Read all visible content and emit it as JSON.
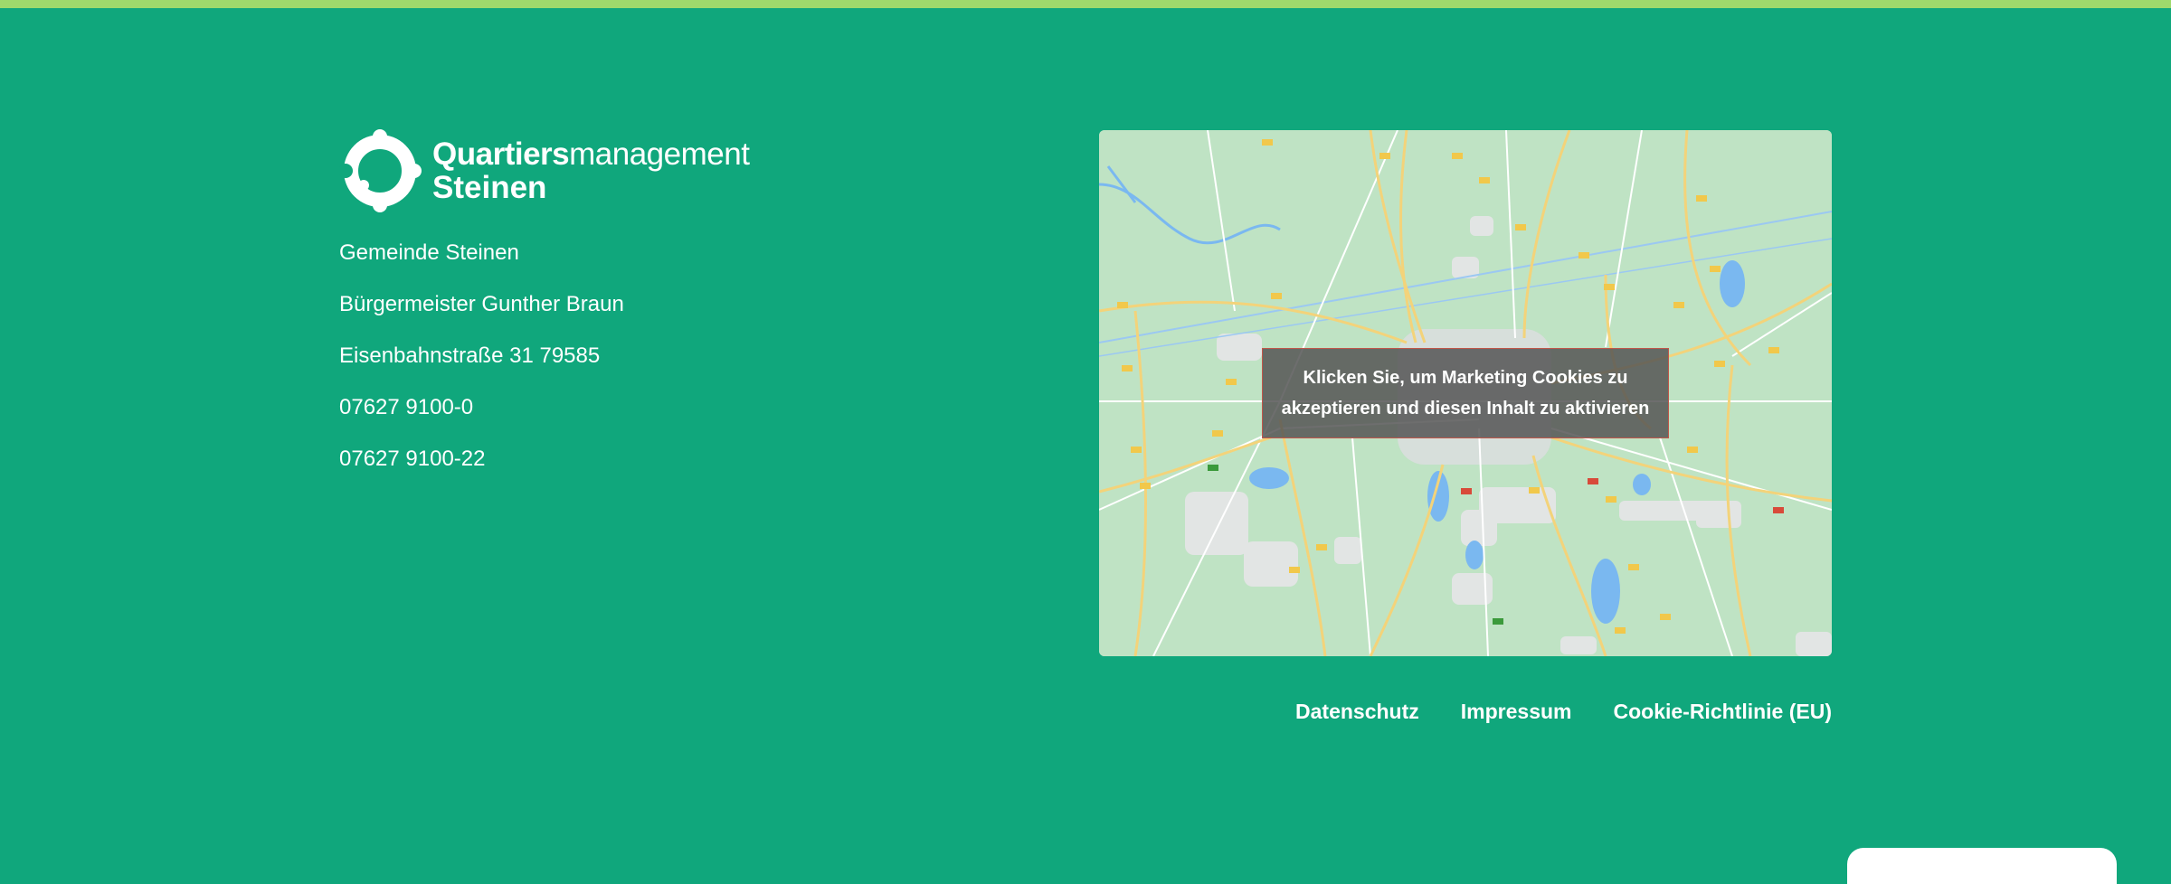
{
  "logo": {
    "line1_bold": "Quartiers",
    "line1_light": "management",
    "line2": "Steinen",
    "icon": "puzzle-ring-logo-icon"
  },
  "contact": {
    "items": [
      "Gemeinde Steinen",
      "Bürgermeister Gunther Braun",
      "Eisenbahnstraße 31 79585",
      "07627 9100-0",
      "07627 9100-22"
    ]
  },
  "map": {
    "overlay_text": "Klicken Sie, um Marketing Cookies zu akzeptieren und diesen Inhalt zu aktivieren"
  },
  "footer": {
    "links": [
      "Datenschutz",
      "Impressum",
      "Cookie-Richtlinie (EU)"
    ]
  },
  "colors": {
    "background": "#10a77c",
    "top_bar": "#9fd96c",
    "text": "#ffffff",
    "overlay": "#555555"
  }
}
